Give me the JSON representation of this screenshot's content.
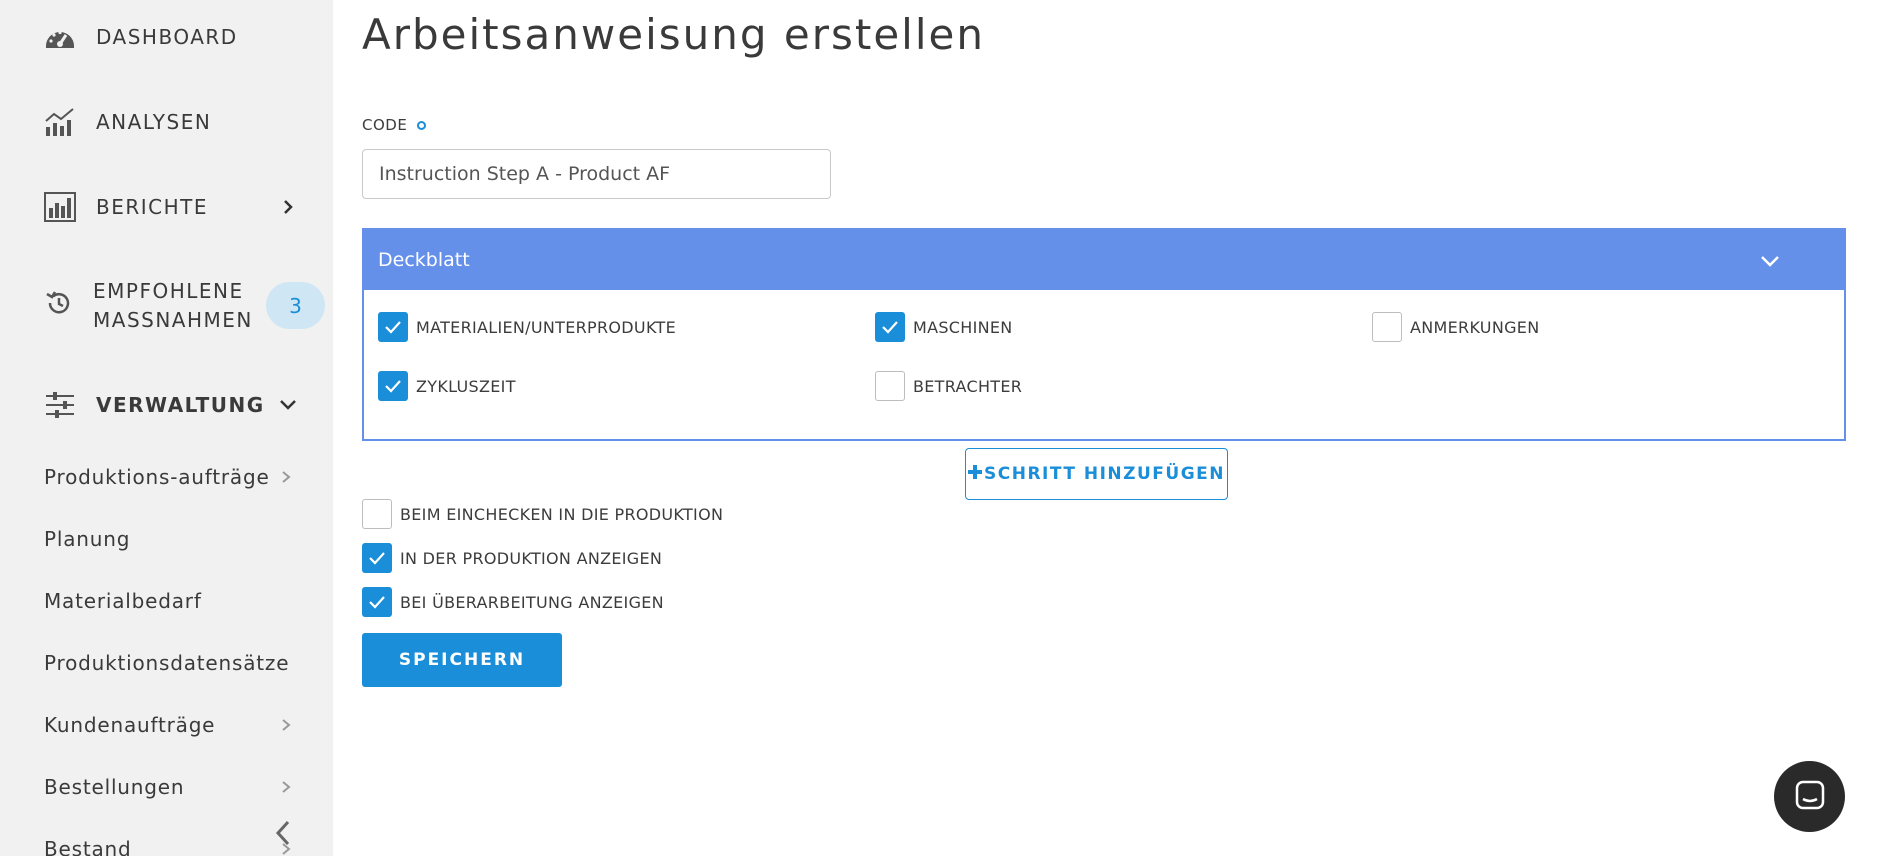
{
  "sidebar": {
    "dashboard": "DASHBOARD",
    "analysen": "ANALYSEN",
    "berichte": "BERICHTE",
    "empfohlene_line1": "EMPFOHLENE",
    "empfohlene_line2": "MASSNAHMEN",
    "empfohlene_badge": "3",
    "verwaltung": "VERWALTUNG",
    "sub_items": [
      {
        "label": "Produktions-aufträge"
      },
      {
        "label": "Planung"
      },
      {
        "label": "Materialbedarf"
      },
      {
        "label": "Produktionsdatensätze"
      },
      {
        "label": "Kundenaufträge"
      },
      {
        "label": "Bestellungen"
      },
      {
        "label": "Bestand"
      }
    ]
  },
  "main": {
    "title": "Arbeitsanweisung erstellen",
    "code_label": "CODE",
    "code_value": "Instruction Step A - Product AF",
    "panel_title": "Deckblatt",
    "panel_options": [
      {
        "label": "MATERIALIEN/UNTERPRODUKTE",
        "checked": true
      },
      {
        "label": "MASCHINEN",
        "checked": true
      },
      {
        "label": "ANMERKUNGEN",
        "checked": false
      },
      {
        "label": "ZYKLUSZEIT",
        "checked": true
      },
      {
        "label": "BETRACHTER",
        "checked": false
      }
    ],
    "add_step_label": "SCHRITT HINZUFÜGEN",
    "add_step_icon": "plus-icon",
    "options": [
      {
        "label": "BEIM EINCHECKEN IN DIE PRODUKTION",
        "checked": false
      },
      {
        "label": "IN DER PRODUKTION ANZEIGEN",
        "checked": true
      },
      {
        "label": "BEI ÜBERARBEITUNG ANZEIGEN",
        "checked": true
      }
    ],
    "save_label": "SPEICHERN"
  },
  "colors": {
    "accent": "#1a8ed8",
    "panel_header": "#6490ea",
    "sidebar_bg": "#f1f1f1",
    "badge_bg": "#cfe6f4"
  }
}
